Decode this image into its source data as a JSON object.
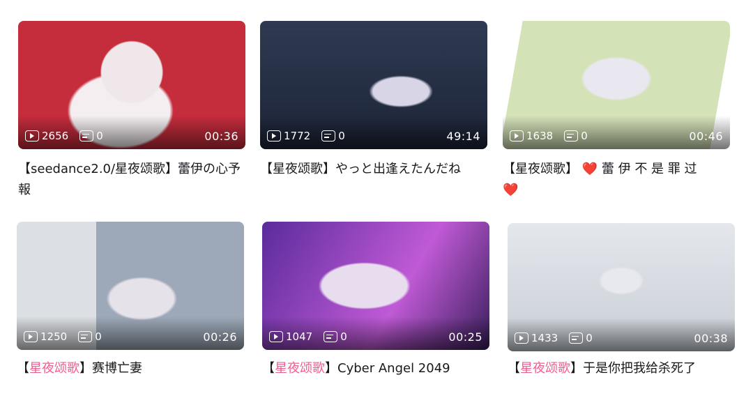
{
  "videos": [
    {
      "views": "2656",
      "danmaku": "0",
      "duration": "00:36",
      "title_prefix": "",
      "title_tag": "",
      "title_text": "【seedance2.0/星夜颂歌】蕾伊の心予報",
      "title_suffix": "",
      "accent": "#c52c3c"
    },
    {
      "views": "1772",
      "danmaku": "0",
      "duration": "49:14",
      "title_prefix": "",
      "title_tag": "",
      "title_text": "【星夜颂歌】やっと出逢えたんだね",
      "title_suffix": "",
      "accent": "#2f3a52"
    },
    {
      "views": "1638",
      "danmaku": "0",
      "duration": "00:46",
      "title_prefix": "",
      "title_tag": "",
      "title_text": "【星夜颂歌】",
      "title_suffix": "蕾 伊 不 是 罪 过",
      "accent": "#d4e2b8"
    },
    {
      "views": "1250",
      "danmaku": "0",
      "duration": "00:26",
      "title_prefix": "【",
      "title_tag": "星夜颂歌",
      "title_text": "】赛博亡妻",
      "title_suffix": "",
      "accent": "#9da9b8"
    },
    {
      "views": "1047",
      "danmaku": "0",
      "duration": "00:25",
      "title_prefix": "【",
      "title_tag": "星夜颂歌",
      "title_text": "】Cyber Angel 2049",
      "title_suffix": "",
      "accent": "#8a3fd0"
    },
    {
      "views": "1433",
      "danmaku": "0",
      "duration": "00:38",
      "title_prefix": "【",
      "title_tag": "星夜颂歌",
      "title_text": "】于是你把我给杀死了",
      "title_suffix": "",
      "accent": "#c9ced6"
    }
  ],
  "heart_glyph": "❤️",
  "colors": {
    "highlight": "#f25d8e",
    "heart": "#e8303b",
    "title": "#18191c"
  },
  "icons": {
    "views": "play-count-icon",
    "danmaku": "danmaku-count-icon"
  }
}
